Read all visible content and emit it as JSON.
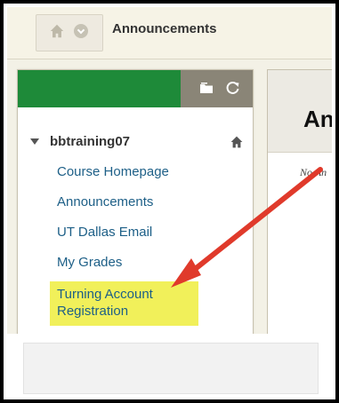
{
  "breadcrumb": {
    "title": "Announcements",
    "home_icon": "home-icon",
    "menu_icon": "chevron-down-icon"
  },
  "sidebar": {
    "header_color": "#1e8a39",
    "tools": [
      "folder-icon",
      "refresh-icon"
    ],
    "course": {
      "name": "bbtraining07",
      "icon": "home-icon"
    },
    "items": [
      {
        "label": "Course Homepage"
      },
      {
        "label": "Announcements"
      },
      {
        "label": "UT Dallas Email"
      },
      {
        "label": "My Grades"
      },
      {
        "label_line1": "Turning Account",
        "label_line2": "Registration",
        "highlight": "#f1f05a"
      }
    ]
  },
  "content": {
    "title": "An",
    "subtitle": "No An"
  },
  "annotation": {
    "arrow_color": "#e03a2b",
    "arrow_icon": "red-arrow-icon"
  }
}
